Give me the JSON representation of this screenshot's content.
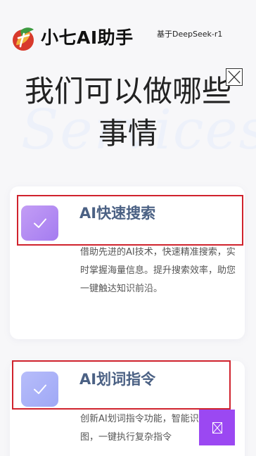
{
  "header": {
    "brand": "小七AI助手",
    "tagline": "基于DeepSeek-r1",
    "logo_icon": "leaf-fruit-logo"
  },
  "hero": {
    "title": "我们可以做哪些事情",
    "background_word": "Services"
  },
  "cards": [
    {
      "title": "AI快速搜索",
      "description": "借助先进的AI技术，快速精准搜索，实时掌握海量信息。提升搜索效率，助您一键触达知识前沿。",
      "icon": "check-icon"
    },
    {
      "title": "AI划词指令",
      "description": "创新AI划词指令功能，智能识别文本意图，一键执行复杂指令",
      "icon": "check-icon"
    }
  ],
  "colors": {
    "accent_purple": "#9b48f2",
    "title_blue": "#4b6184",
    "highlight_red": "#d0232d"
  }
}
